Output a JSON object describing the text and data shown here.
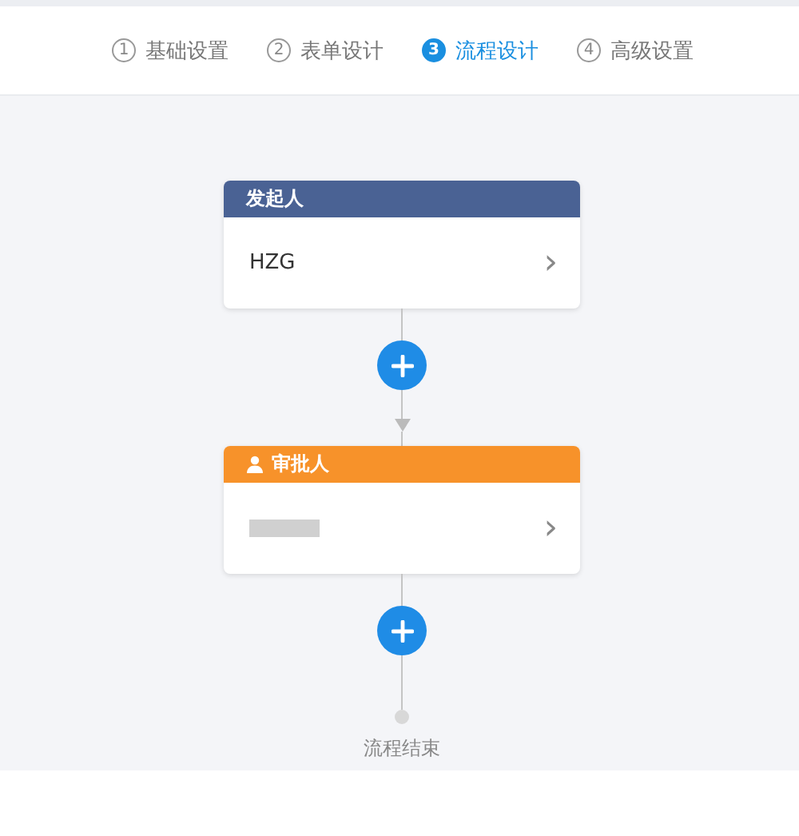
{
  "steps": [
    {
      "number": "1",
      "label": "基础设置",
      "selected": false
    },
    {
      "number": "2",
      "label": "表单设计",
      "selected": false
    },
    {
      "number": "3",
      "label": "流程设计",
      "selected": true
    },
    {
      "number": "4",
      "label": "高级设置",
      "selected": false
    }
  ],
  "flow": {
    "nodes": [
      {
        "kind": "initiator",
        "title": "发起人",
        "color": "#4a6294",
        "value": "HZG",
        "redacted": false,
        "chevron": "›"
      },
      {
        "kind": "approver",
        "title": "审批人",
        "color": "#f7922a",
        "redacted": true,
        "chevron": "›"
      }
    ],
    "end_label": "流程结束"
  }
}
